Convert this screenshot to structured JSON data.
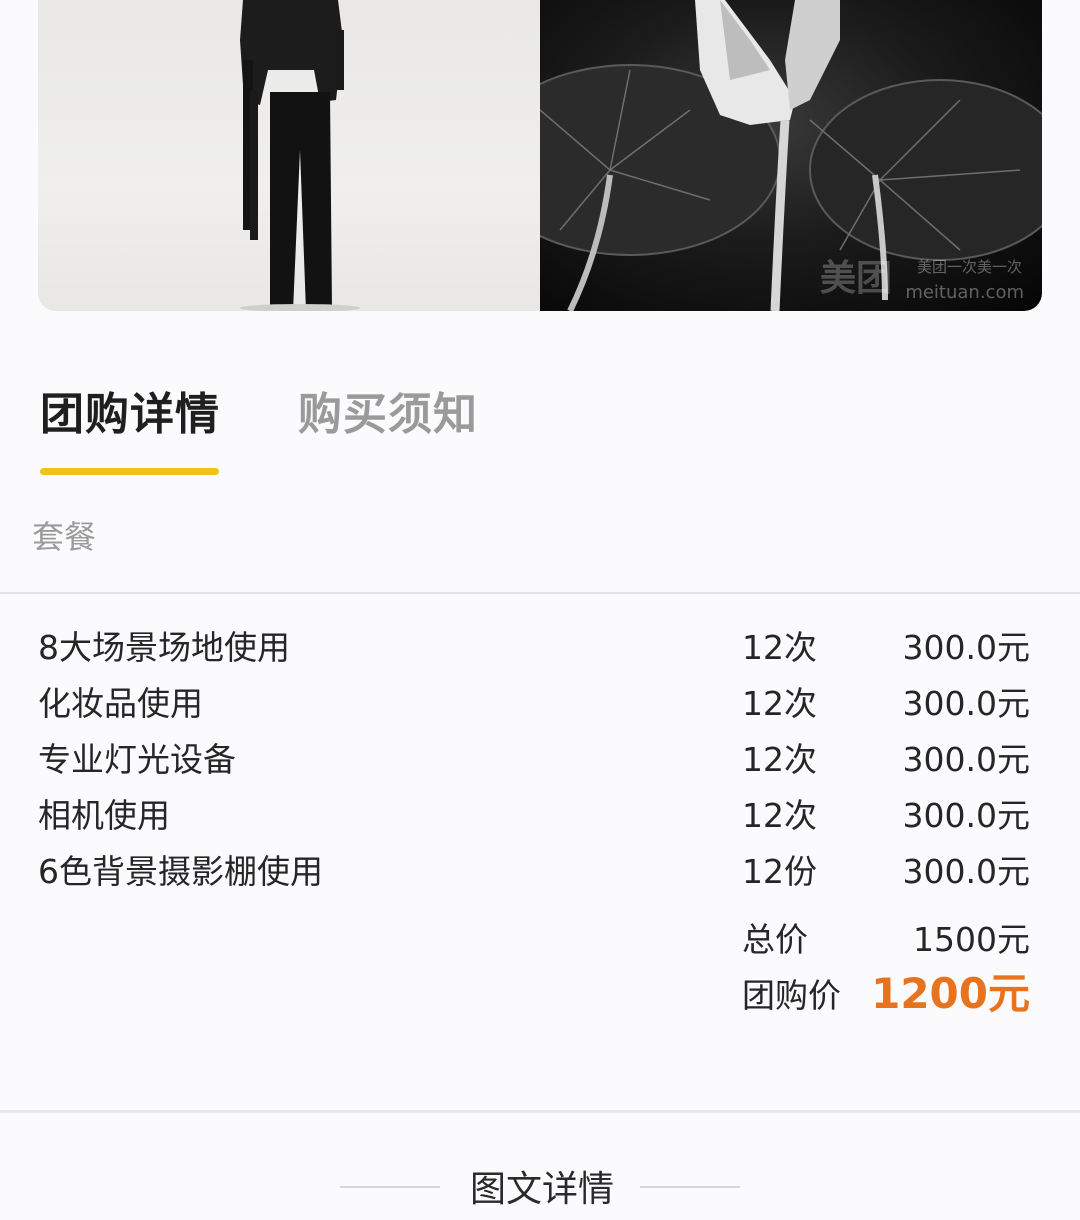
{
  "photos": {
    "watermark_logo": "美团",
    "watermark_slogan": "美团一次美一次",
    "watermark_domain": "meituan.com"
  },
  "tabs": [
    {
      "label": "团购详情",
      "active": true
    },
    {
      "label": "购买须知",
      "active": false
    }
  ],
  "accent_color": "#f2c21a",
  "price_color": "#e8731f",
  "section_label": "套餐",
  "package_items": [
    {
      "name": "8大场景场地使用",
      "qty": "12次",
      "price": "300.0元"
    },
    {
      "name": "化妆品使用",
      "qty": "12次",
      "price": "300.0元"
    },
    {
      "name": "专业灯光设备",
      "qty": "12次",
      "price": "300.0元"
    },
    {
      "name": "相机使用",
      "qty": "12次",
      "price": "300.0元"
    },
    {
      "name": "6色背景摄影棚使用",
      "qty": "12份",
      "price": "300.0元"
    }
  ],
  "totals": {
    "total_label": "总价",
    "total_value": "1500元",
    "group_label": "团购价",
    "group_value": "1200元"
  },
  "detail_title": "图文详情"
}
